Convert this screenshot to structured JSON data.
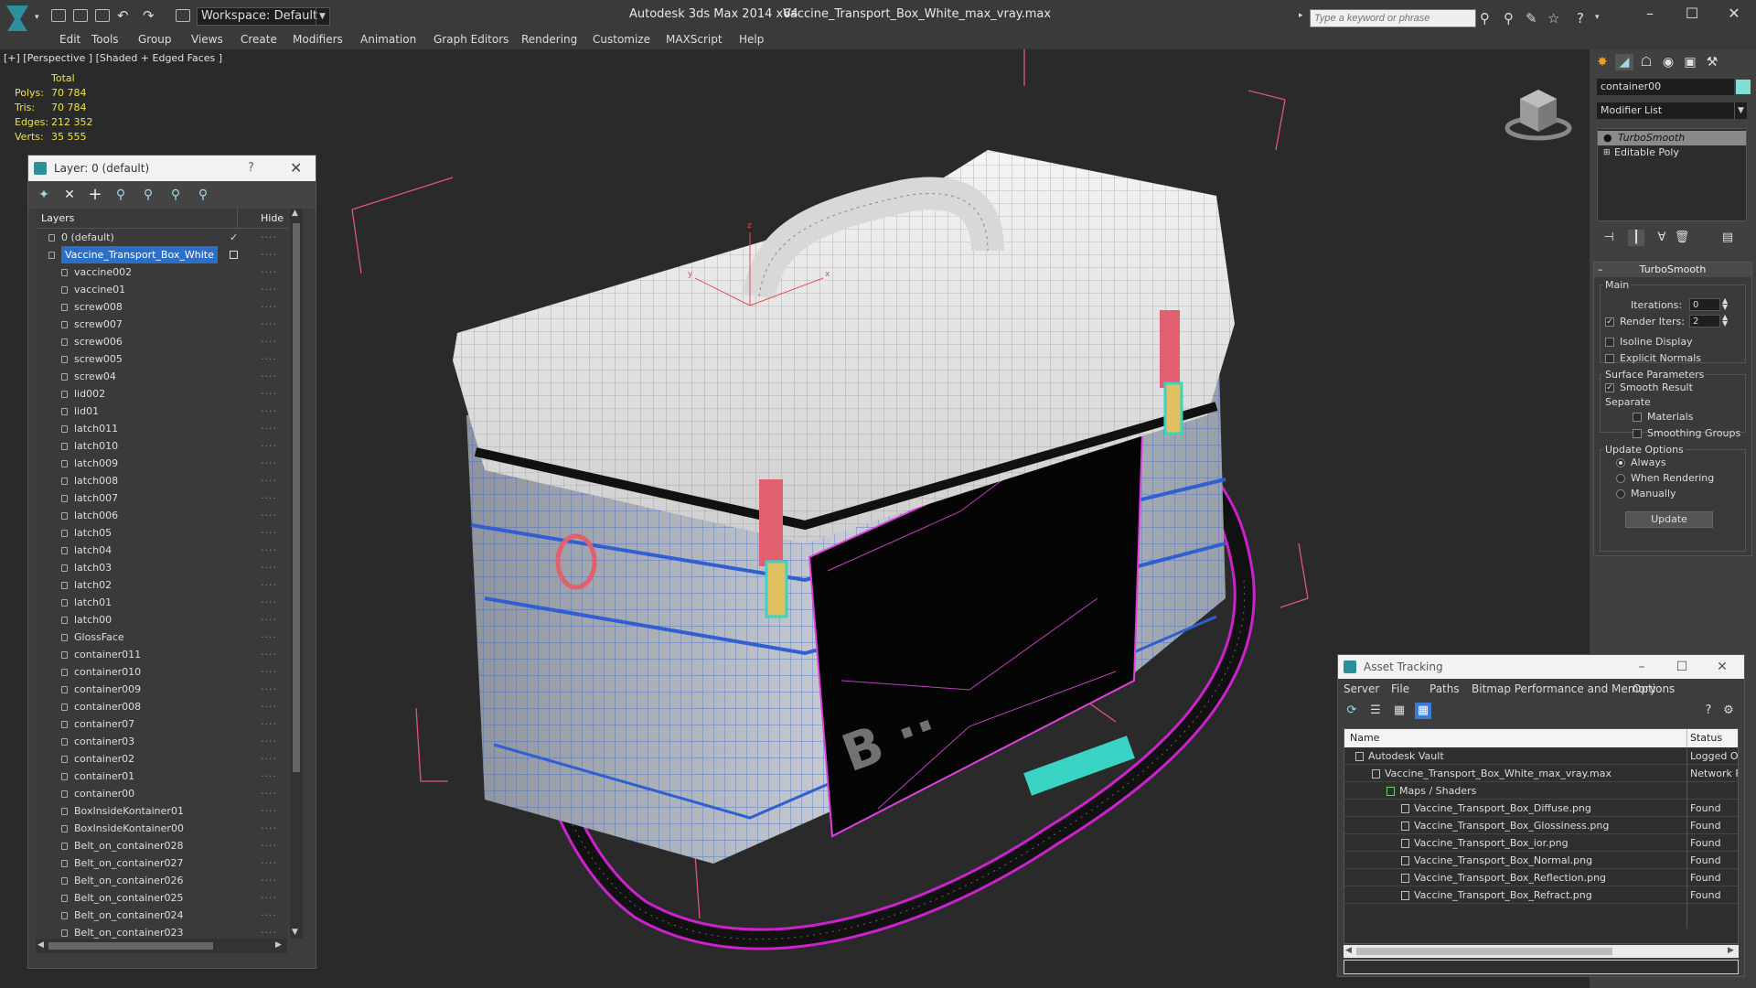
{
  "titlebar": {
    "workspace": "Workspace: Default",
    "app_title": "Autodesk 3ds Max  2014 x64",
    "document": "Vaccine_Transport_Box_White_max_vray.max",
    "search_placeholder": "Type a keyword or phrase",
    "minimize": "–",
    "maximize": "☐",
    "close": "✕"
  },
  "menu": [
    "Edit",
    "Tools",
    "Group",
    "Views",
    "Create",
    "Modifiers",
    "Animation",
    "Graph Editors",
    "Rendering",
    "Customize",
    "MAXScript",
    "Help"
  ],
  "viewport": {
    "label": "[+] [Perspective ] [Shaded + Edged Faces ]",
    "stats": {
      "header": "Total",
      "rows": [
        {
          "k": "Polys:",
          "v": "70 784"
        },
        {
          "k": "Tris:",
          "v": "70 784"
        },
        {
          "k": "Edges:",
          "v": "212 352"
        },
        {
          "k": "Verts:",
          "v": "35 555"
        }
      ]
    },
    "gizmo_labels": {
      "x": "x",
      "y": "y",
      "z": "z"
    }
  },
  "layer_window": {
    "title": "Layer: 0 (default)",
    "help": "?",
    "close": "✕",
    "col_layers": "Layers",
    "col_hide": "Hide",
    "check_mark": "✓",
    "hide_dots": "····",
    "rows": [
      {
        "name": "0 (default)",
        "level": 0,
        "checked": true
      },
      {
        "name": "Vaccine_Transport_Box_White",
        "level": 0,
        "selected": true
      },
      {
        "name": "vaccine002",
        "level": 1
      },
      {
        "name": "vaccine01",
        "level": 1
      },
      {
        "name": "screw008",
        "level": 1
      },
      {
        "name": "screw007",
        "level": 1
      },
      {
        "name": "screw006",
        "level": 1
      },
      {
        "name": "screw005",
        "level": 1
      },
      {
        "name": "screw04",
        "level": 1
      },
      {
        "name": "lid002",
        "level": 1
      },
      {
        "name": "lid01",
        "level": 1
      },
      {
        "name": "latch011",
        "level": 1
      },
      {
        "name": "latch010",
        "level": 1
      },
      {
        "name": "latch009",
        "level": 1
      },
      {
        "name": "latch008",
        "level": 1
      },
      {
        "name": "latch007",
        "level": 1
      },
      {
        "name": "latch006",
        "level": 1
      },
      {
        "name": "latch05",
        "level": 1
      },
      {
        "name": "latch04",
        "level": 1
      },
      {
        "name": "latch03",
        "level": 1
      },
      {
        "name": "latch02",
        "level": 1
      },
      {
        "name": "latch01",
        "level": 1
      },
      {
        "name": "latch00",
        "level": 1
      },
      {
        "name": "GlossFace",
        "level": 1
      },
      {
        "name": "container011",
        "level": 1
      },
      {
        "name": "container010",
        "level": 1
      },
      {
        "name": "container009",
        "level": 1
      },
      {
        "name": "container008",
        "level": 1
      },
      {
        "name": "container07",
        "level": 1
      },
      {
        "name": "container03",
        "level": 1
      },
      {
        "name": "container02",
        "level": 1
      },
      {
        "name": "container01",
        "level": 1
      },
      {
        "name": "container00",
        "level": 1
      },
      {
        "name": "BoxInsideKontainer01",
        "level": 1
      },
      {
        "name": "BoxInsideKontainer00",
        "level": 1
      },
      {
        "name": "Belt_on_container028",
        "level": 1
      },
      {
        "name": "Belt_on_container027",
        "level": 1
      },
      {
        "name": "Belt_on_container026",
        "level": 1
      },
      {
        "name": "Belt_on_container025",
        "level": 1
      },
      {
        "name": "Belt_on_container024",
        "level": 1
      },
      {
        "name": "Belt_on_container023",
        "level": 1
      }
    ]
  },
  "command_panel": {
    "object_name": "container00",
    "modifier_list": "Modifier List",
    "stack": [
      "TurboSmooth",
      "Editable Poly"
    ],
    "rollout": {
      "title": "TurboSmooth",
      "main": "Main",
      "iterations_label": "Iterations:",
      "iterations": "0",
      "render_iters_label": "Render Iters:",
      "render_iters": "2",
      "isoline": "Isoline Display",
      "explicit_normals": "Explicit Normals",
      "surface_params": "Surface Parameters",
      "smooth_result": "Smooth Result",
      "separate": "Separate",
      "materials": "Materials",
      "smoothing_groups": "Smoothing Groups",
      "update_options": "Update Options",
      "always": "Always",
      "when_rendering": "When Rendering",
      "manually": "Manually",
      "update_button": "Update"
    },
    "colors": {
      "object": "#7fe0d0"
    }
  },
  "asset_tracking": {
    "title": "Asset Tracking",
    "minimize": "–",
    "maximize": "☐",
    "close": "✕",
    "menu": [
      "Server",
      "File",
      "Paths",
      "Bitmap Performance and Memory",
      "Options"
    ],
    "col_name": "Name",
    "col_status": "Status",
    "rows": [
      {
        "name": "Autodesk Vault",
        "status": "Logged Out",
        "level": 0
      },
      {
        "name": "Vaccine_Transport_Box_White_max_vray.max",
        "status": "Network Path",
        "level": 1
      },
      {
        "name": "Maps / Shaders",
        "status": "",
        "level": 2
      },
      {
        "name": "Vaccine_Transport_Box_Diffuse.png",
        "status": "Found",
        "level": 3
      },
      {
        "name": "Vaccine_Transport_Box_Glossiness.png",
        "status": "Found",
        "level": 3
      },
      {
        "name": "Vaccine_Transport_Box_ior.png",
        "status": "Found",
        "level": 3
      },
      {
        "name": "Vaccine_Transport_Box_Normal.png",
        "status": "Found",
        "level": 3
      },
      {
        "name": "Vaccine_Transport_Box_Reflection.png",
        "status": "Found",
        "level": 3
      },
      {
        "name": "Vaccine_Transport_Box_Refract.png",
        "status": "Found",
        "level": 3
      }
    ]
  }
}
